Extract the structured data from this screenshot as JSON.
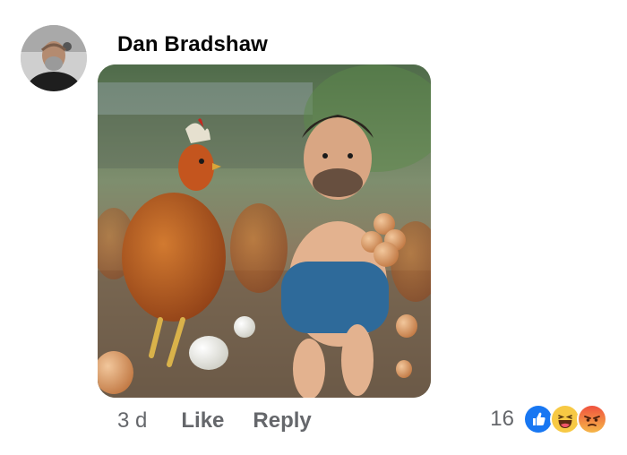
{
  "comment": {
    "author": {
      "name": "Dan Bradshaw",
      "avatar_icon": "profile-photo"
    },
    "attachment": {
      "type": "image",
      "subject": "photo-attachment"
    },
    "meta": {
      "timestamp": "3 d",
      "like_label": "Like",
      "reply_label": "Reply"
    },
    "reactions": {
      "count": "16",
      "types": [
        "like",
        "haha",
        "angry"
      ]
    }
  },
  "colors": {
    "text_primary": "#050505",
    "text_secondary": "#65676b",
    "like_blue": "#1877f2",
    "haha_yellow": "#f7c944",
    "angry_red": "#f0523e"
  }
}
